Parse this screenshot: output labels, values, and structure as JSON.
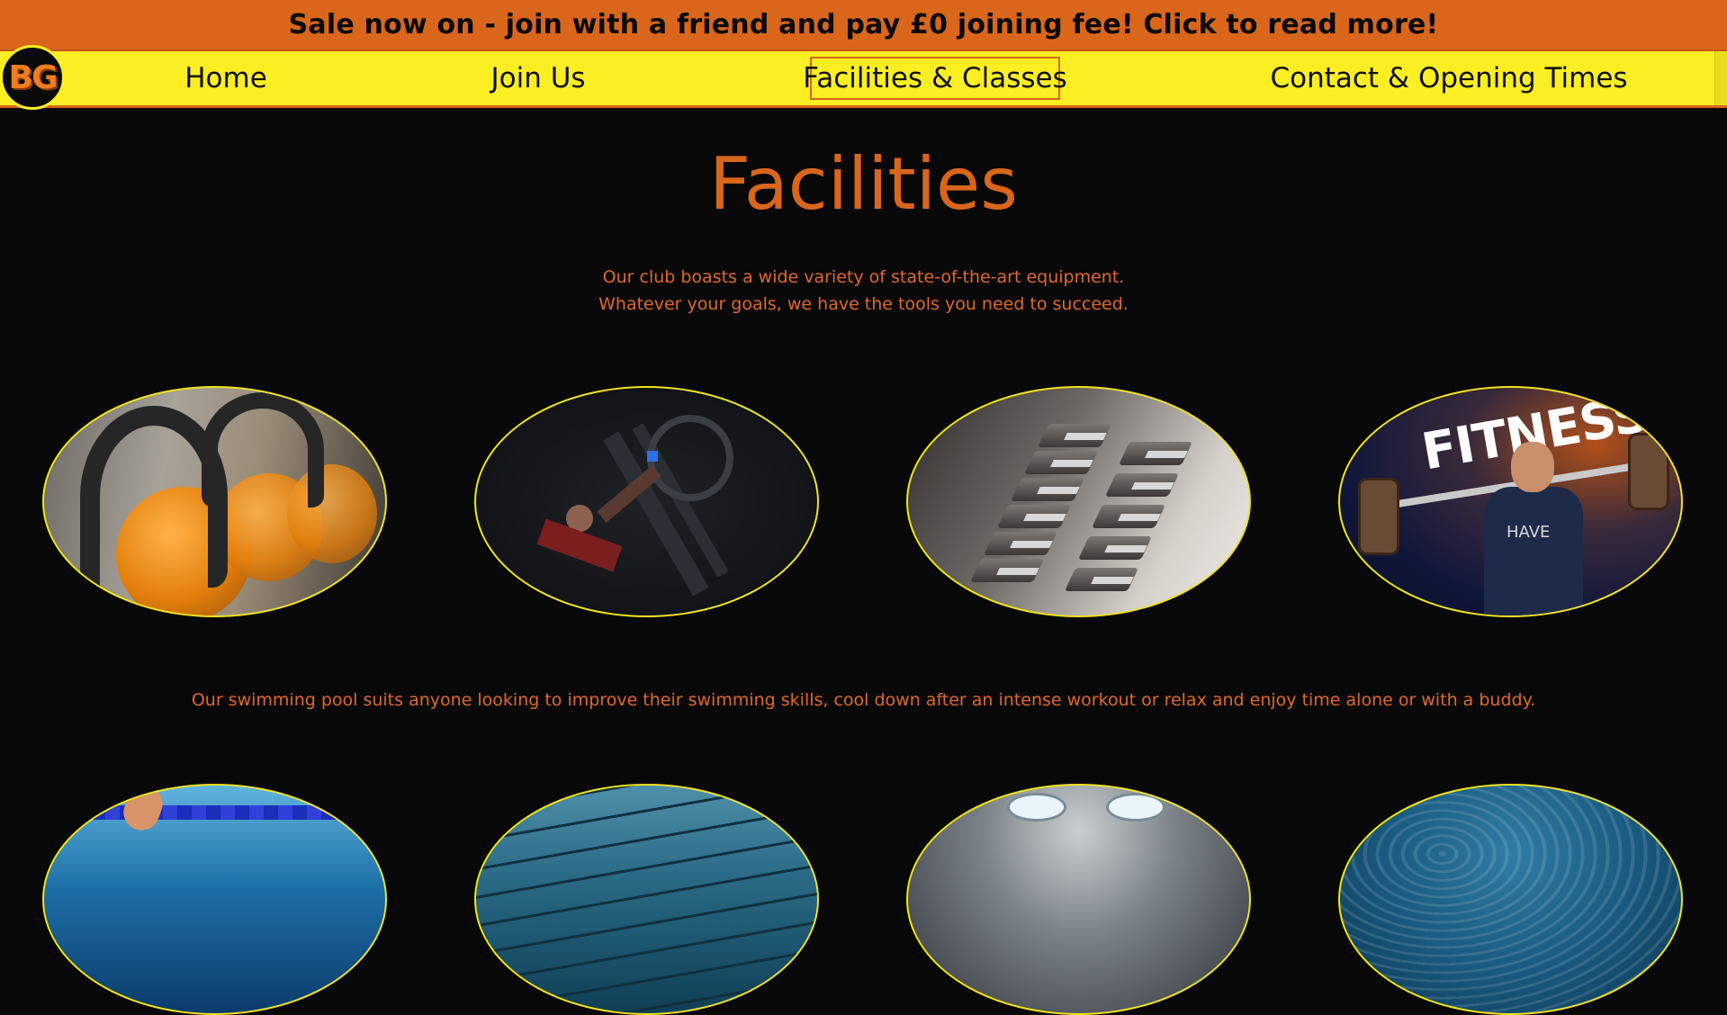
{
  "banner": {
    "text": "Sale now on - join with a friend and pay £0 joining fee! Click to read more!"
  },
  "logo": {
    "text": "BG"
  },
  "nav": {
    "items": [
      {
        "label": "Home"
      },
      {
        "label": "Join Us"
      },
      {
        "label": "Facilities & Classes",
        "active": true
      },
      {
        "label": "Contact & Opening Times"
      }
    ]
  },
  "main": {
    "title": "Facilities",
    "intro_line1": "Our club boasts a wide variety of state-of-the-art equipment.",
    "intro_line2": "Whatever your goals, we have the tools you need to succeed.",
    "pool_text": "Our swimming pool suits anyone looking to improve their swimming skills, cool down after an intense workout or relax and enjoy time alone or with a buddy.",
    "gym_images": [
      {
        "icon": "kettlebells-photo"
      },
      {
        "icon": "leg-press-photo"
      },
      {
        "icon": "dumbbells-photo"
      },
      {
        "icon": "fitness-barbell-photo",
        "overlay_text": "FITNESS",
        "shirt_text": "HAVE"
      }
    ],
    "pool_images": [
      {
        "icon": "swimmer-photo"
      },
      {
        "icon": "pool-lanes-photo"
      },
      {
        "icon": "indoor-pool-ceiling-photo"
      },
      {
        "icon": "pool-water-photo"
      }
    ]
  },
  "colors": {
    "banner_bg": "#d9661b",
    "nav_bg": "#fbee23",
    "page_bg": "#080808",
    "accent": "#d9661b",
    "oval_border": "#f2e21e"
  }
}
